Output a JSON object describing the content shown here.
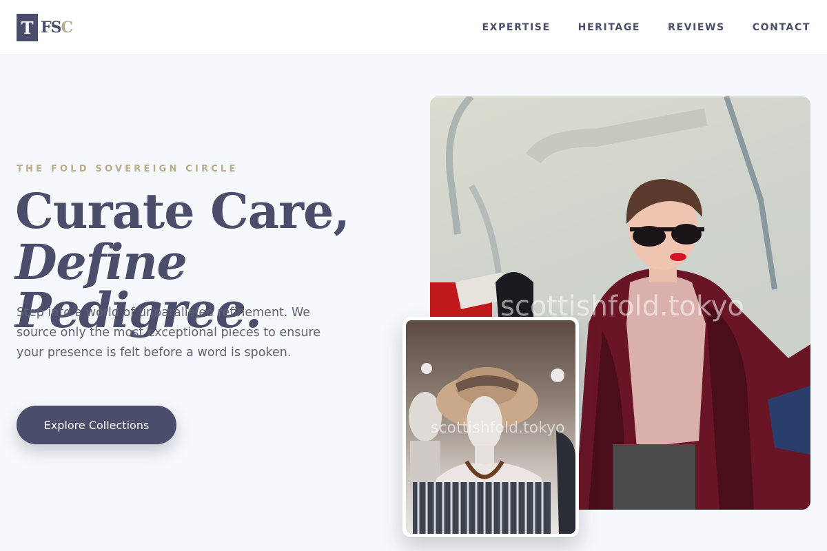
{
  "brand": {
    "mark": "T",
    "letters_primary": "FS",
    "letters_accent": "C",
    "accent_color": "#b9ae8a",
    "primary_color": "#4a4e6b"
  },
  "nav": {
    "items": [
      {
        "label": "EXPERTISE"
      },
      {
        "label": "HERITAGE"
      },
      {
        "label": "REVIEWS"
      },
      {
        "label": "CONTACT"
      }
    ]
  },
  "hero": {
    "eyebrow": "THE FOLD SOVEREIGN CIRCLE",
    "headline_line1": "Curate Care,",
    "headline_line2": "Define Pedigree.",
    "body": "Step into a world of unparalleled refinement. We source only the most exceptional pieces to ensure your presence is felt before a word is spoken.",
    "cta_label": "Explore Collections"
  },
  "images": {
    "main_watermark": "scottishfold.tokyo",
    "inset_watermark": "scottishfold.tokyo"
  }
}
